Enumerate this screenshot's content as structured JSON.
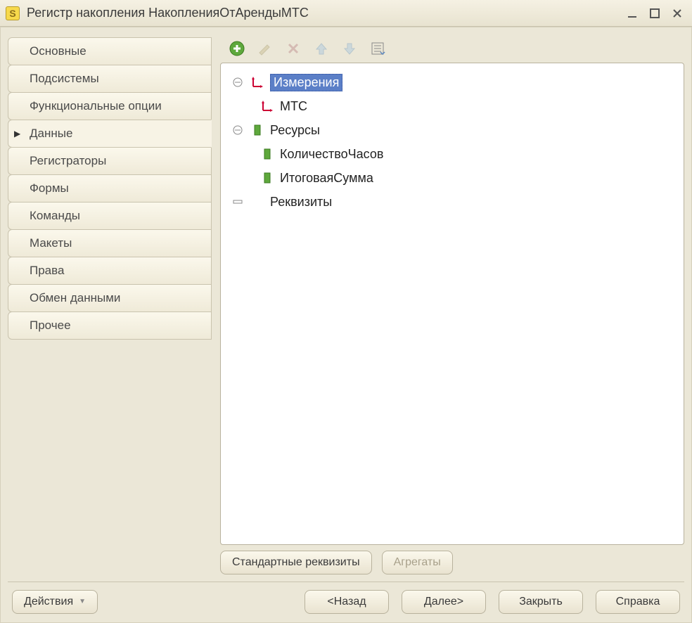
{
  "window": {
    "title": "Регистр накопления НакопленияОтАрендыМТС"
  },
  "sidebar": {
    "items": [
      {
        "label": "Основные"
      },
      {
        "label": "Подсистемы"
      },
      {
        "label": "Функциональные опции"
      },
      {
        "label": "Данные"
      },
      {
        "label": "Регистраторы"
      },
      {
        "label": "Формы"
      },
      {
        "label": "Команды"
      },
      {
        "label": "Макеты"
      },
      {
        "label": "Права"
      },
      {
        "label": "Обмен данными"
      },
      {
        "label": "Прочее"
      }
    ],
    "activeIndex": 3
  },
  "tree": {
    "groups": [
      {
        "label": "Измерения",
        "children": [
          {
            "label": "МТС"
          }
        ]
      },
      {
        "label": "Ресурсы",
        "children": [
          {
            "label": "КоличествоЧасов"
          },
          {
            "label": "ИтоговаяСумма"
          }
        ]
      },
      {
        "label": "Реквизиты",
        "children": []
      }
    ],
    "selected": "Измерения"
  },
  "buttons": {
    "standardAttrs": "Стандартные реквизиты",
    "aggregates": "Агрегаты",
    "actions": "Действия",
    "back": "<Назад",
    "next": "Далее>",
    "close": "Закрыть",
    "help": "Справка"
  }
}
